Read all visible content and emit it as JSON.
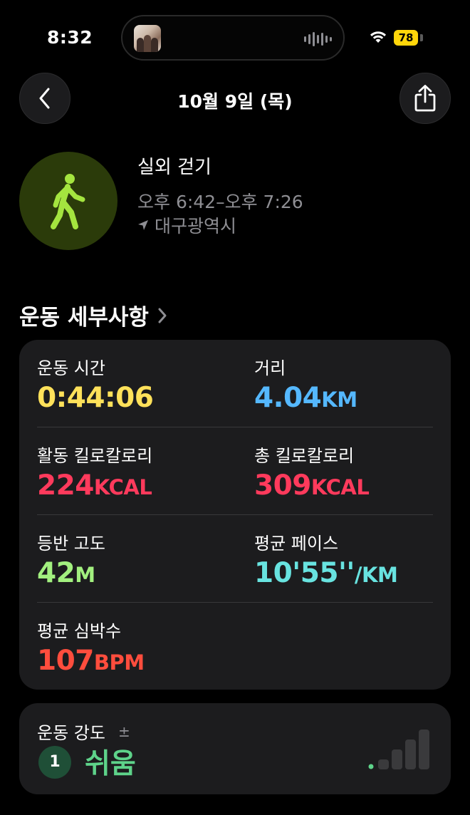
{
  "status_bar": {
    "time": "8:32",
    "battery_level": "78",
    "battery_color": "#ffd60a",
    "icons": [
      "album-art-icon",
      "audio-wave-icon",
      "wifi-icon",
      "battery-icon"
    ]
  },
  "nav": {
    "title": "10월 9일 (목)",
    "back_icon": "chevron-left-icon",
    "share_icon": "share-icon"
  },
  "workout": {
    "icon": "walking-figure-icon",
    "icon_color": "#a4e43f",
    "name": "실외 걷기",
    "time_range": "오후 6:42–오후 7:26",
    "location": "대구광역시",
    "location_icon": "location-arrow-icon"
  },
  "details": {
    "section_title": "운동 세부사항",
    "metrics": [
      {
        "label": "운동 시간",
        "value": "0:44:06",
        "unit": "",
        "color": "#ffe15a"
      },
      {
        "label": "거리",
        "value": "4.04",
        "unit": "KM",
        "color": "#55b8ff"
      },
      {
        "label": "활동 킬로칼로리",
        "value": "224",
        "unit": "KCAL",
        "color": "#ff3a5c"
      },
      {
        "label": "총 킬로칼로리",
        "value": "309",
        "unit": "KCAL",
        "color": "#ff3a5c"
      },
      {
        "label": "등반 고도",
        "value": "42",
        "unit": "M",
        "color": "#a2f07f"
      },
      {
        "label": "평균 페이스",
        "value": "10'55''",
        "unit": "/KM",
        "color": "#68e3e0"
      },
      {
        "label": "평균 심박수",
        "value": "107",
        "unit": "BPM",
        "color": "#ff4d3d"
      }
    ]
  },
  "intensity": {
    "label": "운동 강도",
    "adjust_symbol": "±",
    "level": "1",
    "level_text": "쉬움",
    "level_color": "#5ed38a",
    "bars_filled": 1,
    "bars_total": 5
  }
}
